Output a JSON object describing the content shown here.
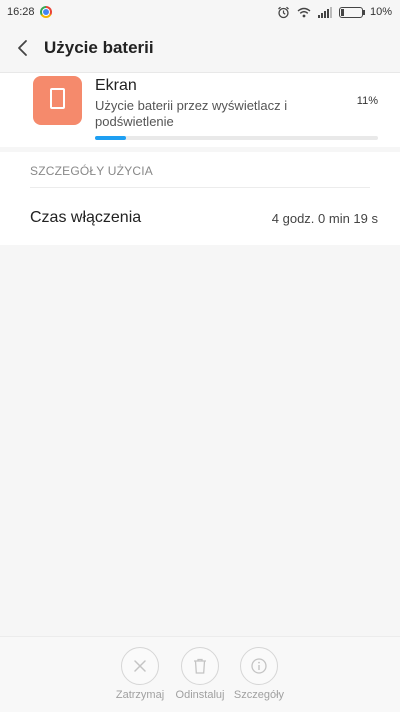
{
  "status_bar": {
    "time": "16:28",
    "battery_text": "10%"
  },
  "header": {
    "title": "Użycie baterii"
  },
  "app": {
    "name": "Ekran",
    "description": "Użycie baterii przez wyświetlacz i podświetlenie",
    "percent_text": "11%",
    "usage_fraction": 0.11,
    "icon_color": "#f58a6c"
  },
  "details": {
    "section_title": "SZCZEGÓŁY UŻYCIA",
    "rows": [
      {
        "label": "Czas włączenia",
        "value": "4 godz. 0 min 19 s"
      }
    ]
  },
  "actions": [
    {
      "label": "Zatrzymaj",
      "icon": "close-icon"
    },
    {
      "label": "Odinstaluj",
      "icon": "trash-icon"
    },
    {
      "label": "Szczegóły",
      "icon": "info-icon"
    }
  ],
  "accent_color": "#1e9ff2"
}
